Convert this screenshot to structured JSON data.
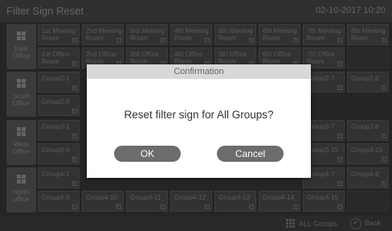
{
  "header": {
    "title": "Filter Sign Reset",
    "datetime": "02-10-2017  10:20"
  },
  "rows": [
    {
      "name": "East Office",
      "cells": [
        "1st Meeting Room",
        "2nd Meeting Room",
        "3rd Meeting Room",
        "4th Meeting Room",
        "5th Meeting Room",
        "6th Meeting Room",
        "7th Meeting Room",
        "8th Meeting Room"
      ]
    },
    {
      "name": "East Office",
      "cells": [
        "1st Office Room",
        "2nd Office Room",
        "3rd Office Room",
        "4th Office Room",
        "5th Office Room",
        "6th Office Room",
        "7th Office Room",
        ""
      ]
    },
    {
      "name": "South Office",
      "cells": [
        "Group2-1",
        "",
        "",
        "",
        "",
        "",
        "Group2-7",
        "Group2-8"
      ]
    },
    {
      "name": "South Office",
      "cells": [
        "Group2-9",
        "",
        "",
        "",
        "",
        "",
        "",
        ""
      ]
    },
    {
      "name": "West Office",
      "cells": [
        "Group3-1",
        "",
        "",
        "",
        "",
        "",
        "Group3-7",
        "Group3-8"
      ]
    },
    {
      "name": "West Office",
      "cells": [
        "Group3-9",
        "",
        "",
        "",
        "",
        "",
        "Group3-15",
        "Group3-16"
      ]
    },
    {
      "name": "North office",
      "cells": [
        "Group4-1",
        "",
        "",
        "",
        "",
        "",
        "Group4-7",
        "Group4-8"
      ]
    },
    {
      "name": "North office",
      "cells": [
        "Group4-9",
        "Group4-10",
        "Group4-11",
        "Group4-12",
        "Group4-13",
        "Group4-14",
        "Group4-15",
        ""
      ]
    }
  ],
  "dialog": {
    "title": "Confirmation",
    "message": "Reset filter sign for All Groups?",
    "ok_label": "OK",
    "cancel_label": "Cancel"
  },
  "footer": {
    "all_groups_label": "ALL Groups",
    "back_label": "Back"
  },
  "icons": {
    "filter_sign": "filter-sign-icon",
    "group_grid": "grid-icon",
    "all_groups": "all-groups-icon",
    "back": "back-icon"
  }
}
